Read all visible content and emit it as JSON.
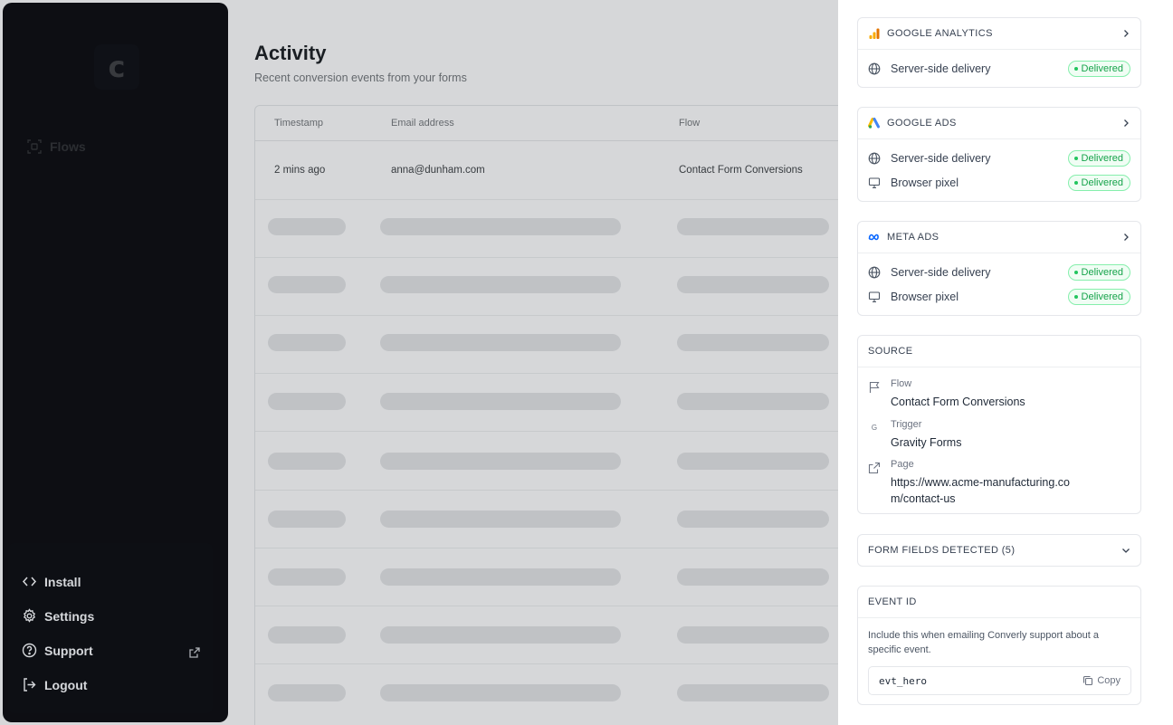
{
  "sidebar": {
    "logo_letter": "c",
    "flows_label": "Flows",
    "bottom": [
      {
        "label": "Install",
        "icon": "code-icon"
      },
      {
        "label": "Settings",
        "icon": "gear-icon"
      },
      {
        "label": "Support",
        "icon": "help-circle-icon"
      },
      {
        "label": "Logout",
        "icon": "logout-icon"
      }
    ]
  },
  "main": {
    "title": "Activity",
    "subtitle": "Recent conversion events from your forms",
    "columns": [
      "Timestamp",
      "Email address",
      "Flow"
    ],
    "rows": [
      {
        "timestamp": "2 mins ago",
        "email": "anna@dunham.com",
        "flow": "Contact Form Conversions"
      }
    ]
  },
  "panel": {
    "destinations": [
      {
        "name": "GOOGLE ANALYTICS",
        "icon": "google-analytics-icon",
        "rows": [
          {
            "label": "Server-side delivery",
            "status": "Delivered",
            "icon": "globe-icon"
          }
        ]
      },
      {
        "name": "GOOGLE ADS",
        "icon": "google-ads-icon",
        "rows": [
          {
            "label": "Server-side delivery",
            "status": "Delivered",
            "icon": "globe-icon"
          },
          {
            "label": "Browser pixel",
            "status": "Delivered",
            "icon": "monitor-icon"
          }
        ]
      },
      {
        "name": "META ADS",
        "icon": "meta-icon",
        "rows": [
          {
            "label": "Server-side delivery",
            "status": "Delivered",
            "icon": "globe-icon"
          },
          {
            "label": "Browser pixel",
            "status": "Delivered",
            "icon": "monitor-icon"
          }
        ]
      }
    ],
    "source": {
      "title": "SOURCE",
      "flow_label": "Flow",
      "flow_value": "Contact Form Conversions",
      "trigger_label": "Trigger",
      "trigger_value": "Gravity Forms",
      "trigger_icon_letter": "G",
      "page_label": "Page",
      "page_value": "https://www.acme-manufacturing.com/contact-us"
    },
    "form_fields": {
      "title": "FORM FIELDS DETECTED (5)"
    },
    "event": {
      "title": "EVENT ID",
      "description": "Include this when emailing Converly support about a specific event.",
      "id": "evt_hero",
      "copy_label": "Copy"
    }
  },
  "colors": {
    "sidebar_bg": "#0c0d12",
    "delivered_green": "#16a34a",
    "delivered_bg": "#f0fdf4",
    "panel_bg": "#ffffff"
  }
}
